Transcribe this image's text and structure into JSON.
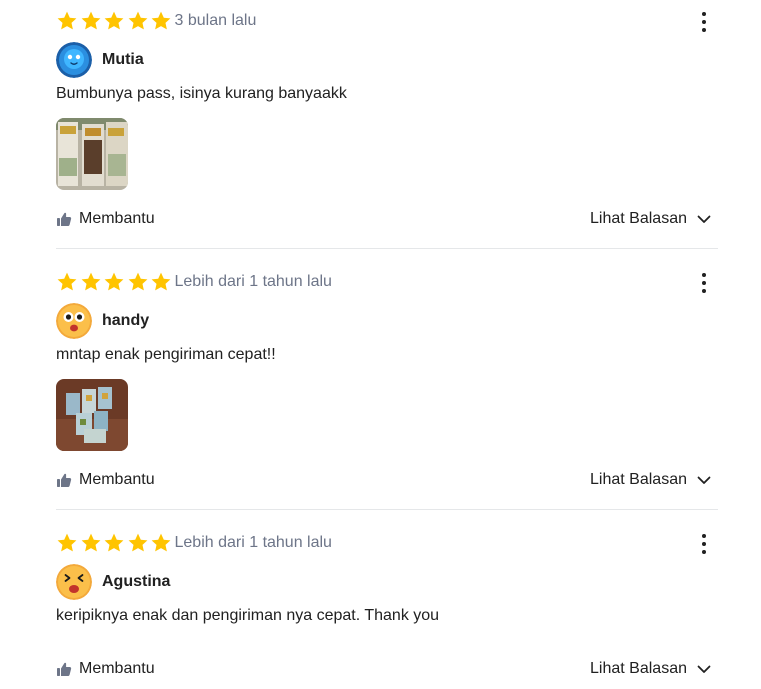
{
  "colors": {
    "star": "#FFC400",
    "text": "#212121",
    "muted": "#6D7588",
    "divider": "#E5E7E9"
  },
  "reviews": [
    {
      "rating": 5,
      "date": "3 bulan lalu",
      "username": "Mutia",
      "avatar_icon": "blue-smiley-avatar",
      "text": "Bumbunya pass, isinya kurang banyaakk",
      "has_photo": true,
      "helpful_label": "Membantu",
      "replies_label": "Lihat Balasan"
    },
    {
      "rating": 5,
      "date": "Lebih dari 1 tahun lalu",
      "username": "handy",
      "avatar_icon": "surprised-face-avatar",
      "text": "mntap enak pengiriman cepat!!",
      "has_photo": true,
      "helpful_label": "Membantu",
      "replies_label": "Lihat Balasan"
    },
    {
      "rating": 5,
      "date": "Lebih dari 1 tahun lalu",
      "username": "Agustina",
      "avatar_icon": "laughing-face-avatar",
      "text": "keripiknya enak dan pengiriman nya cepat. Thank you",
      "has_photo": false,
      "helpful_label": "Membantu",
      "replies_label": "Lihat Balasan"
    }
  ]
}
